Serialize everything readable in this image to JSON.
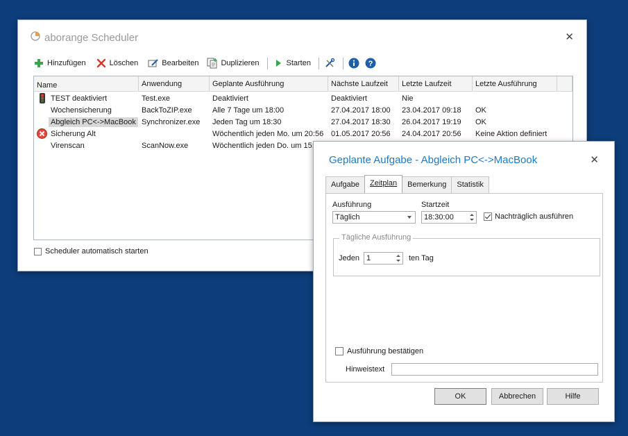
{
  "main_window": {
    "title": "aborange Scheduler",
    "toolbar": {
      "add": "Hinzufügen",
      "delete": "Löschen",
      "edit": "Bearbeiten",
      "duplicate": "Duplizieren",
      "start": "Starten"
    },
    "columns": [
      "Name",
      "Anwendung",
      "Geplante Ausführung",
      "Nächste Laufzeit",
      "Letzte Laufzeit",
      "Letzte Ausführung"
    ],
    "rows": [
      {
        "icon": "traffic-light-icon",
        "name": "TEST deaktiviert",
        "app": "Test.exe",
        "schedule": "Deaktiviert",
        "next": "Deaktiviert",
        "last": "Nie",
        "last_result": ""
      },
      {
        "icon": "",
        "name": "Wochensicherung",
        "app": "BackToZIP.exe",
        "schedule": "Alle 7 Tage um 18:00",
        "next": "27.04.2017 18:00",
        "last": "23.04.2017 09:18",
        "last_result": "OK"
      },
      {
        "icon": "",
        "name": "Abgleich PC<->MacBook",
        "app": "Synchronizer.exe",
        "schedule": "Jeden Tag um 18:30",
        "next": "27.04.2017 18:30",
        "last": "26.04.2017 19:19",
        "last_result": "OK"
      },
      {
        "icon": "error-icon",
        "name": "Sicherung Alt",
        "app": "",
        "schedule": "Wöchentlich jeden Mo. um 20:56",
        "next": "01.05.2017 20:56",
        "last": "24.04.2017 20:56",
        "last_result": "Keine Aktion definiert"
      },
      {
        "icon": "",
        "name": "Virenscan",
        "app": "ScanNow.exe",
        "schedule": "Wöchentlich jeden Do. um 15:",
        "next": "",
        "last": "",
        "last_result": ""
      }
    ],
    "selected_row": 2,
    "autostart_label": "Scheduler automatisch starten",
    "autostart_checked": false
  },
  "dialog": {
    "title": "Geplante Aufgabe - Abgleich PC<->MacBook",
    "tabs": [
      "Aufgabe",
      "Zeitplan",
      "Bemerkung",
      "Statistik"
    ],
    "active_tab": 1,
    "execution_label": "Ausführung",
    "execution_value": "Täglich",
    "starttime_label": "Startzeit",
    "starttime_value": "18:30:00",
    "catchup_label": "Nachträglich ausführen",
    "catchup_checked": true,
    "daily_group_title": "Tägliche Ausführung",
    "every_label": "Jeden",
    "every_value": "1",
    "day_suffix": "ten Tag",
    "confirm_label": "Ausführung bestätigen",
    "confirm_checked": false,
    "hint_label": "Hinweistext",
    "hint_value": "",
    "ok": "OK",
    "cancel": "Abbrechen",
    "help": "Hilfe"
  },
  "colors": {
    "desktop": "#0d3d7a",
    "dialog_title": "#1e7ac8",
    "add_icon": "#3aa54a",
    "delete_icon": "#d9362b",
    "info_icon": "#1f5fa8"
  }
}
